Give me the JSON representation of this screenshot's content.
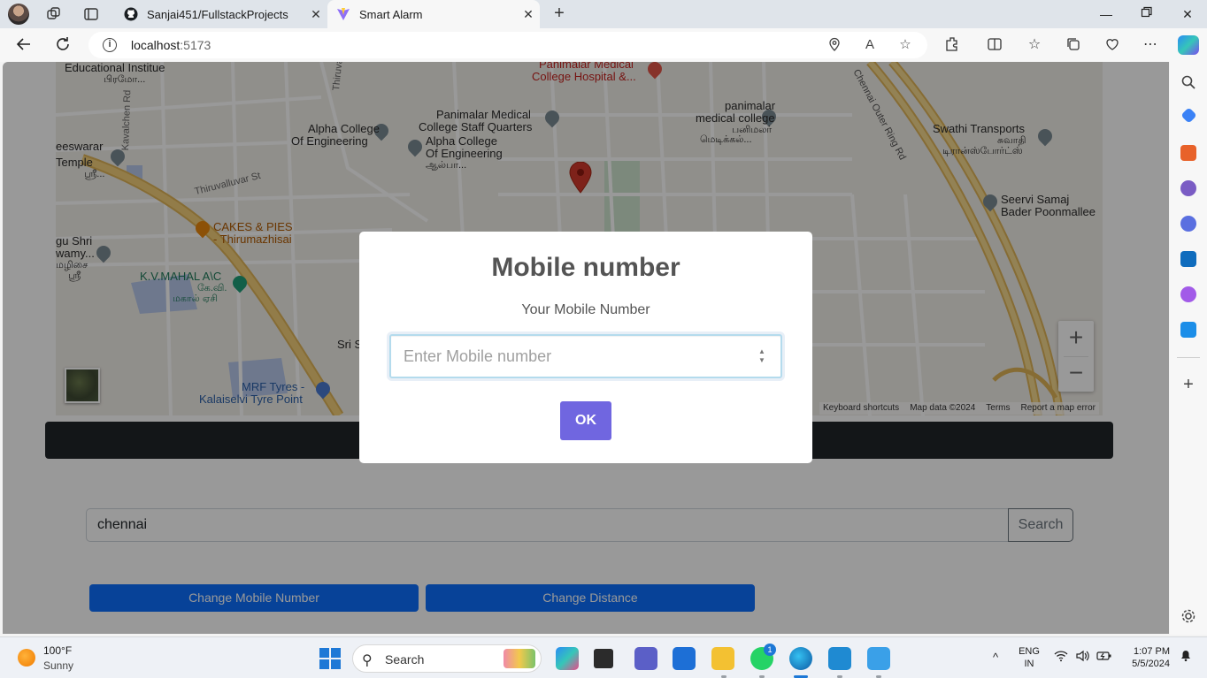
{
  "browser": {
    "tabs": [
      {
        "label": "Sanjai451/FullstackProjects",
        "icon": "github-icon",
        "active": false
      },
      {
        "label": "Smart Alarm",
        "icon": "vite-icon",
        "active": true
      }
    ],
    "url_host": "localhost",
    "url_port": ":5173"
  },
  "map": {
    "labels": {
      "edu_institute": "Educational Institue",
      "edu_tamil": "பிரமோ...",
      "panimalar_hospital_1": "Panimalar Medical",
      "panimalar_hospital_2": "College Hospital &...",
      "panimalar_staff_1": "Panimalar Medical",
      "panimalar_staff_2": "College Staff Quarters",
      "alpha_1": "Alpha College",
      "alpha_2": "Of Engineering",
      "alpha2_1": "Alpha College",
      "alpha2_2": "Of Engineering",
      "alpha2_3": "ஆல்பா...",
      "panimalar_mc_1": "panimalar",
      "panimalar_mc_2": "medical college",
      "panimalar_mc_3": "பனிமலர்",
      "panimalar_mc_4": "மெடிக்கல்...",
      "swathi_1": "Swathi Transports",
      "swathi_2": "சுவாதி",
      "swathi_3": "டிரான்ஸ்போர்ட்ஸ்",
      "seervi_1": "Seervi Samaj",
      "seervi_2": "Bader Poonmallee",
      "eeswarar_1": "eeswarar",
      "eeswarar_2": "Temple",
      "eeswarar_3": "ஸ்ரீ...",
      "kavalchen": "Kavalchen Rd",
      "thiruvalluvar": "Thiruvalluvar St",
      "thiruv_top": "Thiruva",
      "cakes_1": "CAKES & PIES",
      "cakes_2": "- Thirumazhisai",
      "gushri_1": "gu Shri",
      "gushri_2": "wamy...",
      "gushri_3": "மழிசை",
      "gushri_4": "ஸ்ரீ",
      "kvmahal_1": "K.V.MAHAL A\\C",
      "kvmahal_2": "கே.வி.",
      "kvmahal_3": "மகால் ஏசி",
      "srisi": "Sri S",
      "mrf_1": "MRF Tyres -",
      "mrf_2": "Kalaiselvi Tyre Point",
      "outer_ring": "Chennai Outer Ring Rd"
    },
    "attribution": {
      "shortcuts": "Keyboard shortcuts",
      "mapdata": "Map data ©2024",
      "terms": "Terms",
      "report": "Report a map error"
    },
    "zoom_in": "+",
    "zoom_out": "−"
  },
  "page": {
    "search_value": "chennai",
    "search_button": "Search",
    "change_mobile": "Change Mobile Number",
    "change_distance": "Change Distance"
  },
  "modal": {
    "title": "Mobile number",
    "subtitle": "Your Mobile Number",
    "placeholder": "Enter Mobile number",
    "ok": "OK"
  },
  "taskbar": {
    "temp": "100°F",
    "condition": "Sunny",
    "search": "Search",
    "whatsapp_badge": "1",
    "lang_1": "ENG",
    "lang_2": "IN",
    "time": "1:07 PM",
    "date": "5/5/2024"
  }
}
